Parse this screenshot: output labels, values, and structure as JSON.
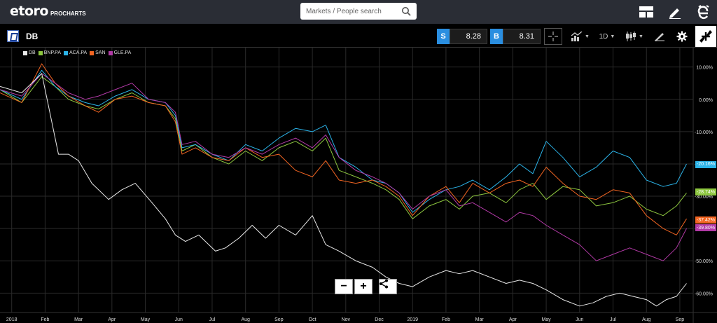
{
  "header": {
    "logo_main": "etoro",
    "logo_sub": "PROCHARTS",
    "search_placeholder": "Markets / People search"
  },
  "toolbar": {
    "symbol": "DB",
    "sell_label": "S",
    "sell_price": "8.28",
    "buy_label": "B",
    "buy_price": "8.31",
    "interval": "1D"
  },
  "colors": {
    "topbar": "#2a2d35",
    "accent_blue": "#2a8ee0"
  },
  "chart_data": {
    "type": "line",
    "y_unit": "%",
    "ylim": [
      -66,
      16
    ],
    "y_ticks": [
      "10.00%",
      "0.00%",
      "-10.00%",
      "-20.00%",
      "-30.00%",
      "-40.00%",
      "-50.00%",
      "-60.00%"
    ],
    "y_tick_values": [
      10,
      0,
      -10,
      -20,
      -30,
      -40,
      -50,
      -60
    ],
    "x_ticks": [
      "2018",
      "Feb",
      "Mar",
      "Apr",
      "May",
      "Jun",
      "Jul",
      "Aug",
      "Sep",
      "Oct",
      "Nov",
      "Dec",
      "2019",
      "Feb",
      "Mar",
      "Apr",
      "May",
      "Jun",
      "Jul",
      "Aug",
      "Sep"
    ],
    "x_tick_months": [
      0,
      1,
      2,
      3,
      4,
      5,
      6,
      7,
      8,
      9,
      10,
      11,
      12,
      13,
      14,
      15,
      16,
      17,
      18,
      19,
      20
    ],
    "x_range_months": [
      -0.35,
      20.4
    ],
    "grid": true,
    "legend_position": "top-left",
    "series": [
      {
        "name": "DB",
        "color": "#e8e8e8",
        "last_label": "",
        "x": [
          -0.35,
          0.3,
          0.9,
          1.1,
          1.4,
          1.7,
          2.0,
          2.4,
          2.9,
          3.3,
          3.7,
          4.2,
          4.6,
          4.9,
          5.2,
          5.6,
          6.1,
          6.4,
          6.8,
          7.2,
          7.6,
          8.0,
          8.5,
          9.0,
          9.4,
          9.8,
          10.3,
          10.8,
          11.2,
          11.6,
          12.0,
          12.5,
          13.0,
          13.4,
          13.8,
          14.3,
          14.8,
          15.2,
          15.6,
          16.0,
          16.5,
          17.0,
          17.4,
          17.8,
          18.2,
          18.6,
          19.0,
          19.3,
          19.6,
          19.9,
          20.2
        ],
        "y": [
          4,
          2,
          8,
          -2,
          -17,
          -17,
          -19,
          -26,
          -31,
          -28,
          -26,
          -32,
          -37,
          -42,
          -44,
          -42,
          -47,
          -46,
          -43,
          -39,
          -43,
          -39,
          -42,
          -36,
          -45,
          -47,
          -50,
          -52,
          -55,
          -57,
          -58,
          -55,
          -53,
          -54,
          -53,
          -55,
          -57,
          -56,
          -57,
          -59,
          -62,
          -64,
          -63,
          -61,
          -60,
          -61,
          -62,
          -64,
          -62,
          -61,
          -57
        ]
      },
      {
        "name": "BNP.PA",
        "color": "#8dc63f",
        "last_label": "-28.74%",
        "x": [
          -0.35,
          0.3,
          0.9,
          1.3,
          1.7,
          2.2,
          2.6,
          3.1,
          3.6,
          4.1,
          4.6,
          4.9,
          5.1,
          5.5,
          6.0,
          6.5,
          7.0,
          7.5,
          8.0,
          8.5,
          9.0,
          9.4,
          9.8,
          10.3,
          10.8,
          11.2,
          11.6,
          12.0,
          12.5,
          13.0,
          13.4,
          13.8,
          14.3,
          14.8,
          15.2,
          15.6,
          16.0,
          16.5,
          17.0,
          17.5,
          18.0,
          18.5,
          19.0,
          19.5,
          19.9,
          20.2
        ],
        "y": [
          3,
          -1,
          7,
          4,
          0,
          -2,
          -3,
          0,
          2,
          -1,
          -2,
          -6,
          -16,
          -14,
          -18,
          -20,
          -16,
          -19,
          -15,
          -13,
          -16,
          -12,
          -22,
          -24,
          -26,
          -28,
          -31,
          -37,
          -33,
          -31,
          -34,
          -30,
          -29,
          -32,
          -28,
          -26,
          -31,
          -27,
          -28,
          -33,
          -32,
          -30,
          -34,
          -36,
          -33,
          -29
        ]
      },
      {
        "name": "ACA.PA",
        "color": "#2bb3e8",
        "last_label": "-20.16%",
        "x": [
          -0.35,
          0.3,
          0.9,
          1.3,
          1.7,
          2.2,
          2.6,
          3.1,
          3.6,
          4.1,
          4.6,
          4.9,
          5.1,
          5.5,
          6.0,
          6.5,
          7.0,
          7.5,
          8.0,
          8.5,
          9.0,
          9.4,
          9.8,
          10.3,
          10.8,
          11.2,
          11.6,
          12.0,
          12.5,
          13.0,
          13.4,
          13.8,
          14.3,
          14.8,
          15.2,
          15.6,
          16.0,
          16.5,
          17.0,
          17.5,
          18.0,
          18.5,
          19.0,
          19.5,
          19.9,
          20.2
        ],
        "y": [
          3,
          0,
          9,
          4,
          1,
          -1,
          -2,
          1,
          3,
          0,
          -1,
          -5,
          -15,
          -14,
          -17,
          -19,
          -14,
          -16,
          -12,
          -9,
          -10,
          -8,
          -18,
          -21,
          -25,
          -26,
          -29,
          -35,
          -31,
          -28,
          -27,
          -25,
          -28,
          -24,
          -20,
          -23,
          -13,
          -18,
          -24,
          -21,
          -16,
          -18,
          -25,
          -27,
          -26,
          -20
        ]
      },
      {
        "name": "SAN",
        "color": "#f26522",
        "last_label": "-37.42%",
        "x": [
          -0.35,
          0.3,
          0.9,
          1.3,
          1.7,
          2.2,
          2.6,
          3.1,
          3.6,
          4.1,
          4.6,
          4.9,
          5.1,
          5.5,
          6.0,
          6.5,
          7.0,
          7.5,
          8.0,
          8.5,
          9.0,
          9.4,
          9.8,
          10.3,
          10.8,
          11.2,
          11.6,
          12.0,
          12.5,
          13.0,
          13.4,
          13.8,
          14.3,
          14.8,
          15.2,
          15.6,
          16.0,
          16.5,
          17.0,
          17.5,
          18.0,
          18.5,
          19.0,
          19.5,
          19.9,
          20.2
        ],
        "y": [
          2,
          -1,
          11,
          5,
          1,
          -2,
          -4,
          0,
          1,
          -1,
          -2,
          -7,
          -17,
          -15,
          -18,
          -19,
          -15,
          -18,
          -17,
          -22,
          -24,
          -19,
          -25,
          -26,
          -25,
          -27,
          -30,
          -36,
          -30,
          -27,
          -32,
          -26,
          -29,
          -26,
          -25,
          -27,
          -21,
          -26,
          -30,
          -31,
          -28,
          -29,
          -36,
          -40,
          -42,
          -37
        ]
      },
      {
        "name": "GLE.PA",
        "color": "#b23aa6",
        "last_label": "-39.80%",
        "x": [
          -0.35,
          0.3,
          0.9,
          1.3,
          1.7,
          2.2,
          2.6,
          3.1,
          3.6,
          4.1,
          4.6,
          4.9,
          5.1,
          5.5,
          6.0,
          6.5,
          7.0,
          7.5,
          8.0,
          8.5,
          9.0,
          9.4,
          9.8,
          10.3,
          10.8,
          11.2,
          11.6,
          12.0,
          12.5,
          13.0,
          13.4,
          13.8,
          14.3,
          14.8,
          15.2,
          15.6,
          16.0,
          16.5,
          17.0,
          17.5,
          18.0,
          18.5,
          19.0,
          19.5,
          19.9,
          20.2
        ],
        "y": [
          3,
          1,
          8,
          5,
          2,
          0,
          1,
          3,
          5,
          0,
          -1,
          -4,
          -14,
          -13,
          -17,
          -18,
          -15,
          -17,
          -14,
          -12,
          -15,
          -11,
          -18,
          -22,
          -24,
          -26,
          -29,
          -34,
          -30,
          -28,
          -33,
          -32,
          -35,
          -38,
          -35,
          -36,
          -39,
          -42,
          -45,
          -50,
          -48,
          -46,
          -48,
          -50,
          -46,
          -40
        ]
      }
    ]
  }
}
